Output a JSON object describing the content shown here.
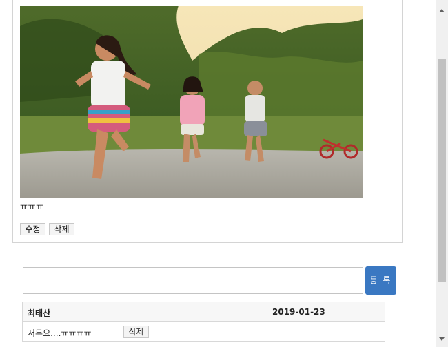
{
  "post": {
    "text": "ㅠㅠㅠ",
    "edit_label": "수정",
    "delete_label": "삭제"
  },
  "comment_form": {
    "input_value": "",
    "submit_label": "등 록"
  },
  "comments": [
    {
      "author": "최태산",
      "date": "2019-01-23",
      "body": "저두요....ㅠㅠㅠㅠ",
      "delete_label": "삭제"
    }
  ],
  "colors": {
    "submit_button": "#3a78c2",
    "scroll_thumb": "#c1c1c1"
  }
}
